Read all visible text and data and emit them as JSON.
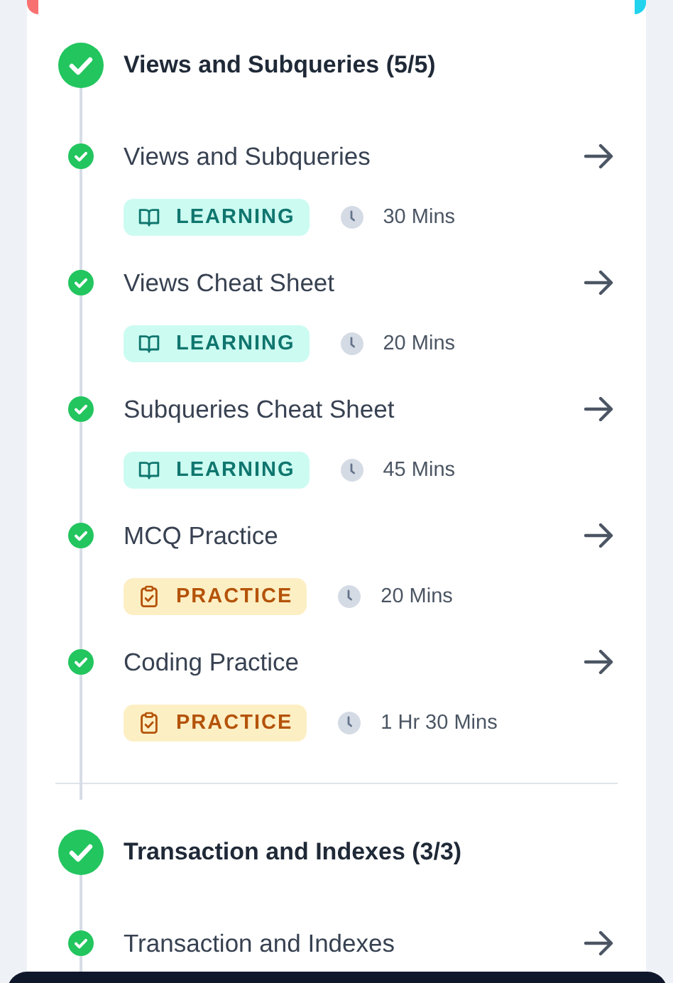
{
  "sections": [
    {
      "title": "Views and Subqueries (5/5)",
      "completed": true,
      "items": [
        {
          "title": "Views and Subqueries",
          "completed": true,
          "kind": "learning",
          "tag": "LEARNING",
          "duration": "30 Mins"
        },
        {
          "title": "Views Cheat Sheet",
          "completed": true,
          "kind": "learning",
          "tag": "LEARNING",
          "duration": "20 Mins"
        },
        {
          "title": "Subqueries Cheat Sheet",
          "completed": true,
          "kind": "learning",
          "tag": "LEARNING",
          "duration": "45 Mins"
        },
        {
          "title": "MCQ Practice",
          "completed": true,
          "kind": "practice",
          "tag": "PRACTICE",
          "duration": "20 Mins"
        },
        {
          "title": "Coding Practice",
          "completed": true,
          "kind": "practice",
          "tag": "PRACTICE",
          "duration": "1 Hr 30 Mins"
        }
      ]
    },
    {
      "title": "Transaction and Indexes (3/3)",
      "completed": true,
      "items": [
        {
          "title": "Transaction and Indexes",
          "completed": true
        }
      ]
    }
  ]
}
